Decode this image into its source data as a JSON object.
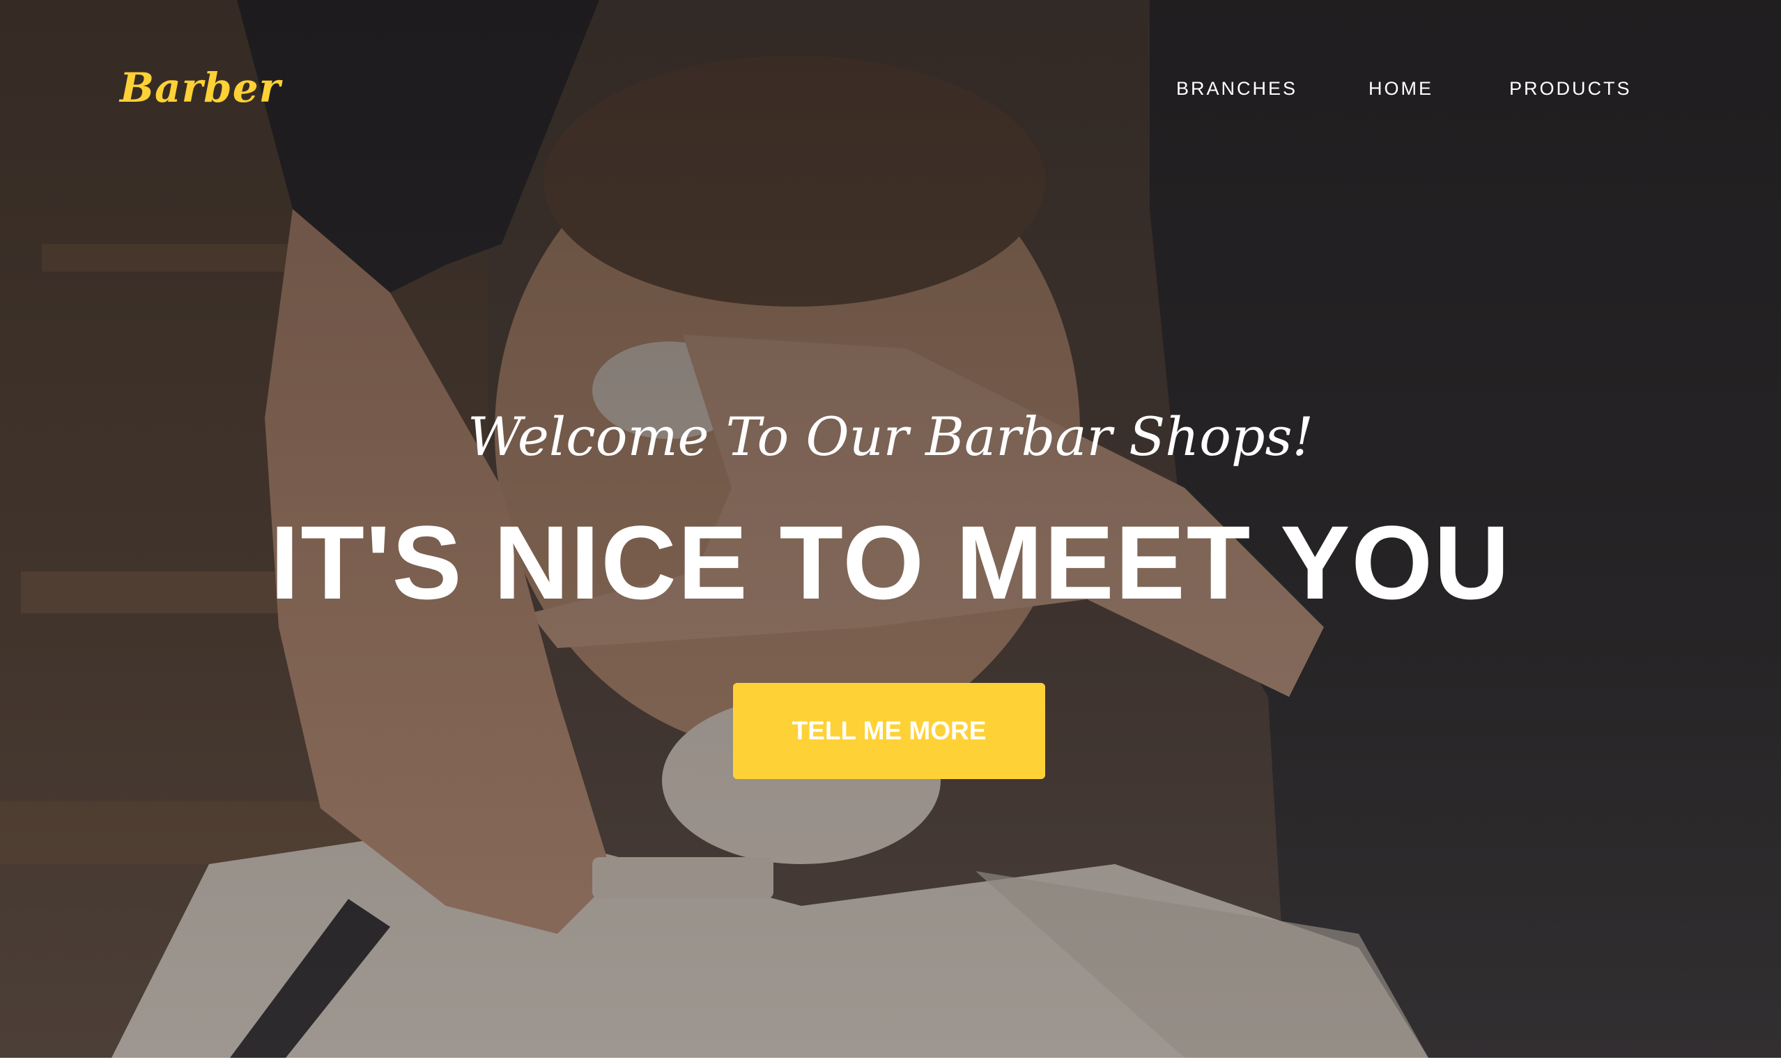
{
  "colors": {
    "accent": "#fed136",
    "text_light": "#ffffff",
    "overlay_dark": "#1e1c20"
  },
  "navbar": {
    "brand": "Barber",
    "links": [
      {
        "label": "BRANCHES"
      },
      {
        "label": "HOME"
      },
      {
        "label": "PRODUCTS"
      }
    ]
  },
  "hero": {
    "lead": "Welcome To Our Barbar Shops!",
    "heading": "IT'S NICE TO MEET YOU",
    "button_label": "TELL ME MORE",
    "background_image": "photo of a barber shaving a customer with a straight razor"
  }
}
